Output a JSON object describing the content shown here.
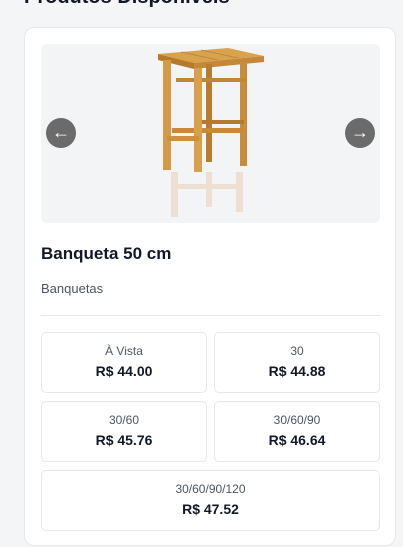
{
  "section": {
    "title": "Produtos Disponíveis"
  },
  "product": {
    "name": "Banqueta 50 cm",
    "category": "Banquetas",
    "carousel": {
      "prev_icon": "←",
      "next_icon": "→"
    }
  },
  "prices": [
    {
      "label": "À Vista",
      "value": "R$ 44.00"
    },
    {
      "label": "30",
      "value": "R$ 44.88"
    },
    {
      "label": "30/60",
      "value": "R$ 45.76"
    },
    {
      "label": "30/60/90",
      "value": "R$ 46.64"
    },
    {
      "label": "30/60/90/120",
      "value": "R$ 47.52"
    }
  ]
}
